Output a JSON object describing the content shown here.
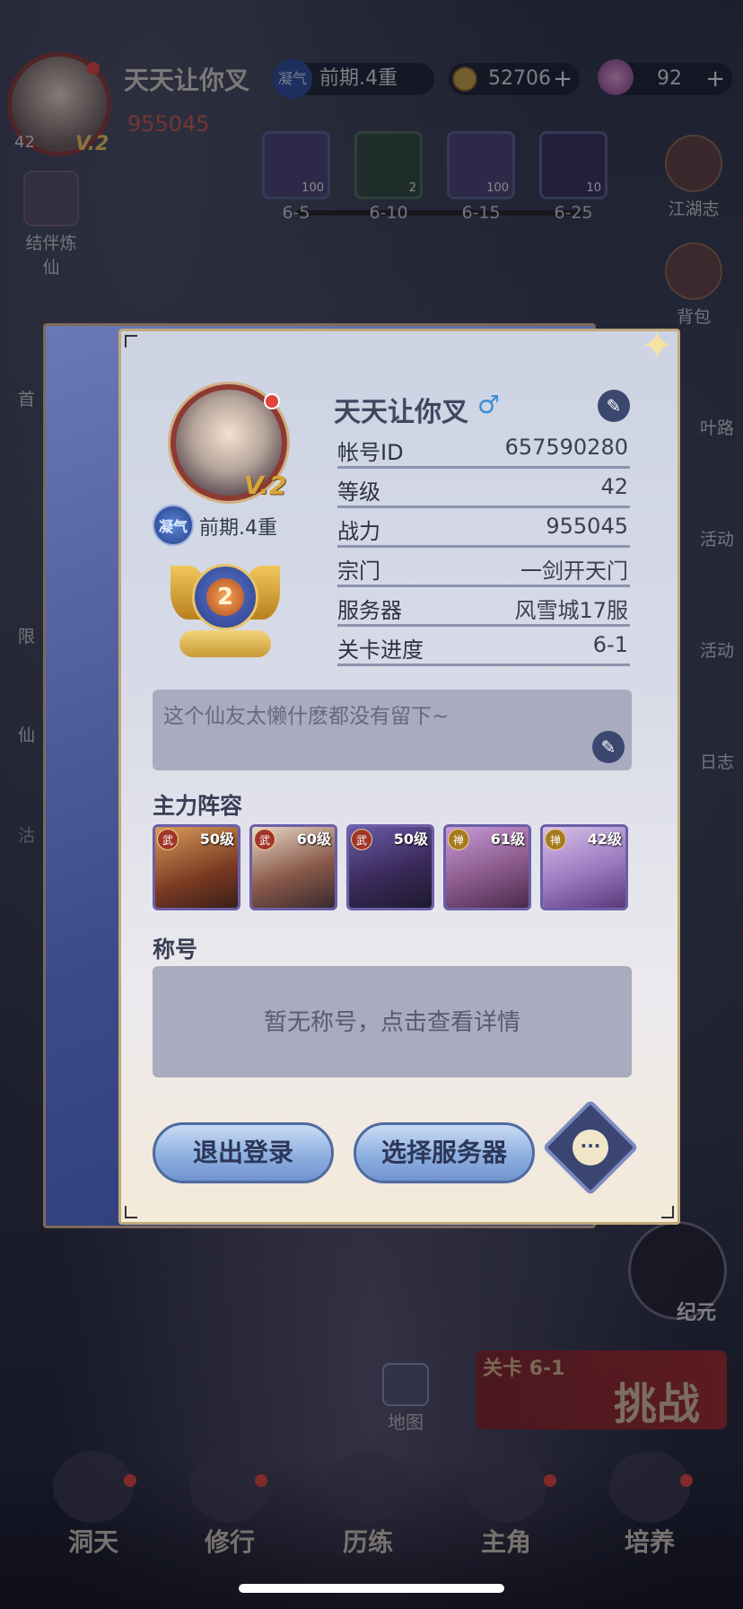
{
  "hud": {
    "player_name": "天天让你叉",
    "level": "42",
    "vip": "V.2",
    "power": "955045",
    "rank": "前期.4重",
    "rank_icon": "凝气",
    "coins": "52706",
    "gems": "92"
  },
  "stage_rewards": [
    {
      "label": "6-5",
      "count": "100"
    },
    {
      "label": "6-10",
      "count": "2"
    },
    {
      "label": "6-15",
      "count": "100"
    },
    {
      "label": "6-25",
      "count": "10"
    }
  ],
  "left_menu": [
    "结伴炼仙",
    "首",
    "限",
    "仙",
    "沽"
  ],
  "right_menu": [
    "江湖志",
    "背包",
    "叶路",
    "活动",
    "活动",
    "日志"
  ],
  "map_label": "地图",
  "challenge": {
    "stage": "关卡 6-1",
    "label": "挑战"
  },
  "epoch_label": "纪元",
  "bottom_nav": [
    "洞天",
    "修行",
    "历练",
    "主角",
    "培养"
  ],
  "profile": {
    "name": "天天让你叉",
    "gender_symbol": "♂",
    "vip": "V.2",
    "rank_icon": "凝气",
    "rank": "前期.4重",
    "badge_level": "2",
    "fields": [
      {
        "key": "帐号ID",
        "value": "657590280"
      },
      {
        "key": "等级",
        "value": "42"
      },
      {
        "key": "战力",
        "value": "955045"
      },
      {
        "key": "宗门",
        "value": "一剑开天门"
      },
      {
        "key": "服务器",
        "value": "风雪城17服"
      },
      {
        "key": "关卡进度",
        "value": "6-1"
      }
    ],
    "signature": "这个仙友太懒什麽都没有留下~",
    "lineup_title": "主力阵容",
    "lineup": [
      {
        "tag": "武",
        "level": "50级",
        "tag_color": "#a2352a"
      },
      {
        "tag": "武",
        "level": "60级",
        "tag_color": "#a2352a"
      },
      {
        "tag": "武",
        "level": "50级",
        "tag_color": "#a2352a"
      },
      {
        "tag": "禅",
        "level": "61级",
        "tag_color": "#a67a1e"
      },
      {
        "tag": "禅",
        "level": "42级",
        "tag_color": "#a67a1e"
      }
    ],
    "title_section": "称号",
    "title_empty": "暂无称号，点击查看详情",
    "buttons": {
      "logout": "退出登录",
      "select_server": "选择服务器",
      "more": "···"
    }
  }
}
